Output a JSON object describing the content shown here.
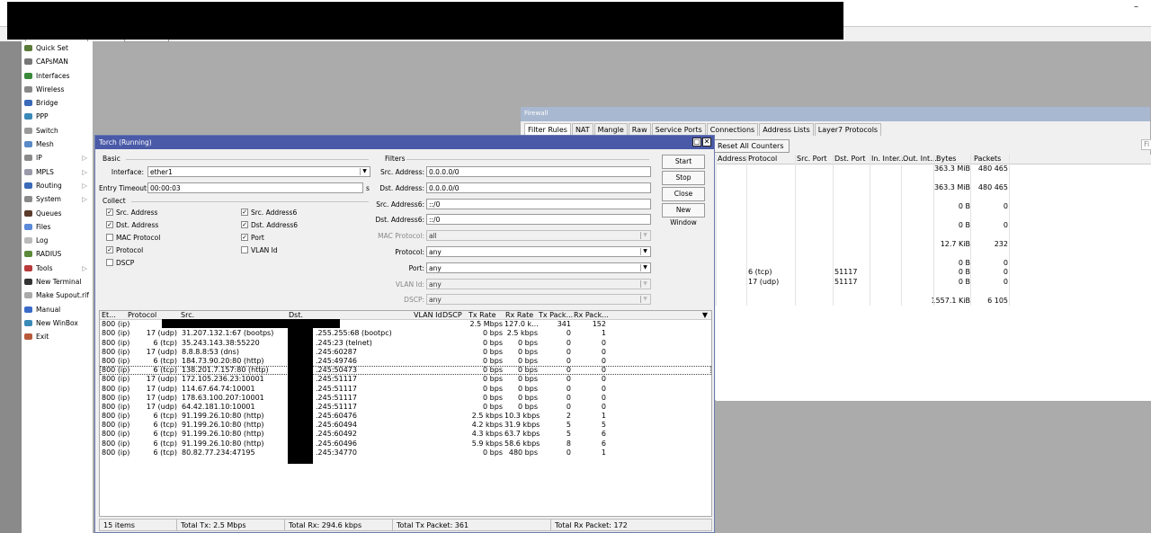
{
  "window": {
    "minimize_glyph": "–"
  },
  "sidebar": {
    "items": [
      {
        "label": "Quick Set",
        "icon": "quick-set-icon",
        "color": "#5a7a3a",
        "arrow": false
      },
      {
        "label": "CAPsMAN",
        "icon": "capsman-icon",
        "color": "#777777",
        "arrow": false
      },
      {
        "label": "Interfaces",
        "icon": "interfaces-icon",
        "color": "#3a8a3a",
        "arrow": false
      },
      {
        "label": "Wireless",
        "icon": "wireless-icon",
        "color": "#888888",
        "arrow": false
      },
      {
        "label": "Bridge",
        "icon": "bridge-icon",
        "color": "#3a6ab8",
        "arrow": false
      },
      {
        "label": "PPP",
        "icon": "ppp-icon",
        "color": "#3a8ab8",
        "arrow": false
      },
      {
        "label": "Switch",
        "icon": "switch-icon",
        "color": "#9a9a9a",
        "arrow": false
      },
      {
        "label": "Mesh",
        "icon": "mesh-icon",
        "color": "#5a8ac8",
        "arrow": false
      },
      {
        "label": "IP",
        "icon": "ip-icon",
        "color": "#8a8a8a",
        "arrow": true
      },
      {
        "label": "MPLS",
        "icon": "mpls-icon",
        "color": "#9a9aaa",
        "arrow": true
      },
      {
        "label": "Routing",
        "icon": "routing-icon",
        "color": "#3a6ab8",
        "arrow": true
      },
      {
        "label": "System",
        "icon": "system-icon",
        "color": "#8a8a8a",
        "arrow": true
      },
      {
        "label": "Queues",
        "icon": "queues-icon",
        "color": "#5a3a2a",
        "arrow": false
      },
      {
        "label": "Files",
        "icon": "files-icon",
        "color": "#5a8ad8",
        "arrow": false
      },
      {
        "label": "Log",
        "icon": "log-icon",
        "color": "#bbbbbb",
        "arrow": false
      },
      {
        "label": "RADIUS",
        "icon": "radius-icon",
        "color": "#5a8a3a",
        "arrow": false
      },
      {
        "label": "Tools",
        "icon": "tools-icon",
        "color": "#b83a3a",
        "arrow": true
      },
      {
        "label": "New Terminal",
        "icon": "terminal-icon",
        "color": "#333333",
        "arrow": false
      },
      {
        "label": "Make Supout.rif",
        "icon": "supout-icon",
        "color": "#aaaaaa",
        "arrow": false
      },
      {
        "label": "Manual",
        "icon": "manual-icon",
        "color": "#3a6ac8",
        "arrow": false
      },
      {
        "label": "New WinBox",
        "icon": "winbox-icon",
        "color": "#3a8ab8",
        "arrow": false
      },
      {
        "label": "Exit",
        "icon": "exit-icon",
        "color": "#b85a3a",
        "arrow": false
      }
    ]
  },
  "firewall": {
    "title": "Firewall",
    "tabs": [
      "Filter Rules",
      "NAT",
      "Mangle",
      "Raw",
      "Service Ports",
      "Connections",
      "Address Lists",
      "Layer7 Protocols"
    ],
    "reset_label": "Reset All Counters",
    "filter_placeholder": "Fi",
    "columns": [
      "Address",
      "Protocol",
      "Src. Port",
      "Dst. Port",
      "In. Inter...",
      "Out. Int...",
      "Bytes",
      "Packets"
    ],
    "rows": [
      {
        "proto": "",
        "dport": "",
        "bytes": "363.3 MiB",
        "packets": "480 465"
      },
      {
        "proto": "",
        "dport": "",
        "bytes": "",
        "packets": ""
      },
      {
        "proto": "",
        "dport": "",
        "bytes": "363.3 MiB",
        "packets": "480 465"
      },
      {
        "proto": "",
        "dport": "",
        "bytes": "",
        "packets": ""
      },
      {
        "proto": "",
        "dport": "",
        "bytes": "0 B",
        "packets": "0"
      },
      {
        "proto": "",
        "dport": "",
        "bytes": "",
        "packets": ""
      },
      {
        "proto": "",
        "dport": "",
        "bytes": "0 B",
        "packets": "0"
      },
      {
        "proto": "",
        "dport": "",
        "bytes": "",
        "packets": ""
      },
      {
        "proto": "",
        "dport": "",
        "bytes": "12.7 KiB",
        "packets": "232"
      },
      {
        "proto": "",
        "dport": "",
        "bytes": "",
        "packets": ""
      },
      {
        "proto": "",
        "dport": "",
        "bytes": "0 B",
        "packets": "0"
      },
      {
        "proto": "6 (tcp)",
        "dport": "51117",
        "bytes": "0 B",
        "packets": "0"
      },
      {
        "proto": "17 (udp)",
        "dport": "51117",
        "bytes": "0 B",
        "packets": "0"
      },
      {
        "proto": "",
        "dport": "",
        "bytes": "",
        "packets": ""
      },
      {
        "proto": "",
        "dport": "",
        "bytes": "1557.1 KiB",
        "packets": "6 105"
      }
    ]
  },
  "torch": {
    "title": "Torch (Running)",
    "basic_label": "Basic",
    "interface_label": "Interface:",
    "interface_value": "ether1",
    "entry_timeout_label": "Entry Timeout:",
    "entry_timeout_value": "00:00:03",
    "entry_timeout_unit": "s",
    "collect_label": "Collect",
    "collect": [
      {
        "label": "Src. Address",
        "checked": true
      },
      {
        "label": "Src. Address6",
        "checked": true
      },
      {
        "label": "Dst. Address",
        "checked": true
      },
      {
        "label": "Dst. Address6",
        "checked": true
      },
      {
        "label": "MAC Protocol",
        "checked": false
      },
      {
        "label": "Port",
        "checked": true
      },
      {
        "label": "Protocol",
        "checked": true
      },
      {
        "label": "VLAN Id",
        "checked": false
      },
      {
        "label": "DSCP",
        "checked": false
      }
    ],
    "filters_label": "Filters",
    "filters": [
      {
        "label": "Src. Address:",
        "value": "0.0.0.0/0",
        "disabled": false,
        "dropdown": false
      },
      {
        "label": "Dst. Address:",
        "value": "0.0.0.0/0",
        "disabled": false,
        "dropdown": false
      },
      {
        "label": "Src. Address6:",
        "value": "::/0",
        "disabled": false,
        "dropdown": false
      },
      {
        "label": "Dst. Address6:",
        "value": "::/0",
        "disabled": false,
        "dropdown": false
      },
      {
        "label": "MAC Protocol:",
        "value": "all",
        "disabled": true,
        "dropdown": true
      },
      {
        "label": "Protocol:",
        "value": "any",
        "disabled": false,
        "dropdown": true
      },
      {
        "label": "Port:",
        "value": "any",
        "disabled": false,
        "dropdown": true
      },
      {
        "label": "VLAN Id:",
        "value": "any",
        "disabled": true,
        "dropdown": true
      },
      {
        "label": "DSCP:",
        "value": "any",
        "disabled": true,
        "dropdown": true
      }
    ],
    "buttons": [
      "Start",
      "Stop",
      "Close",
      "New Window"
    ],
    "columns": [
      "Et...",
      "Protocol",
      "Src.",
      "Dst.",
      "VLAN Id",
      "DSCP",
      "Tx Rate",
      "Rx Rate",
      "Tx Pack...",
      "Rx Pack..."
    ],
    "rows": [
      {
        "et": "800 (ip)",
        "proto": "",
        "src": "",
        "dst": "",
        "tx": "2.5 Mbps",
        "rx": "127.0 k...",
        "txp": "341",
        "rxp": "152"
      },
      {
        "et": "800 (ip)",
        "proto": "17 (udp)",
        "src": "31.207.132.1:67 (bootps)",
        "dst": ".255.255:68 (bootpc)",
        "tx": "0 bps",
        "rx": "2.5 kbps",
        "txp": "0",
        "rxp": "1"
      },
      {
        "et": "800 (ip)",
        "proto": "6 (tcp)",
        "src": "35.243.143.38:55220",
        "dst": ".245:23 (telnet)",
        "tx": "0 bps",
        "rx": "0 bps",
        "txp": "0",
        "rxp": "0"
      },
      {
        "et": "800 (ip)",
        "proto": "17 (udp)",
        "src": "8.8.8.8:53 (dns)",
        "dst": ".245:60287",
        "tx": "0 bps",
        "rx": "0 bps",
        "txp": "0",
        "rxp": "0"
      },
      {
        "et": "800 (ip)",
        "proto": "6 (tcp)",
        "src": "184.73.90.20:80 (http)",
        "dst": ".245:49746",
        "tx": "0 bps",
        "rx": "0 bps",
        "txp": "0",
        "rxp": "0"
      },
      {
        "et": "800 (ip)",
        "proto": "6 (tcp)",
        "src": "138.201.7.157:80 (http)",
        "dst": ".245:50473",
        "tx": "0 bps",
        "rx": "0 bps",
        "txp": "0",
        "rxp": "0",
        "sel": true
      },
      {
        "et": "800 (ip)",
        "proto": "17 (udp)",
        "src": "172.105.236.23:10001",
        "dst": ".245:51117",
        "tx": "0 bps",
        "rx": "0 bps",
        "txp": "0",
        "rxp": "0"
      },
      {
        "et": "800 (ip)",
        "proto": "17 (udp)",
        "src": "114.67.64.74:10001",
        "dst": ".245:51117",
        "tx": "0 bps",
        "rx": "0 bps",
        "txp": "0",
        "rxp": "0"
      },
      {
        "et": "800 (ip)",
        "proto": "17 (udp)",
        "src": "178.63.100.207:10001",
        "dst": ".245:51117",
        "tx": "0 bps",
        "rx": "0 bps",
        "txp": "0",
        "rxp": "0"
      },
      {
        "et": "800 (ip)",
        "proto": "17 (udp)",
        "src": "64.42.181.10:10001",
        "dst": ".245:51117",
        "tx": "0 bps",
        "rx": "0 bps",
        "txp": "0",
        "rxp": "0"
      },
      {
        "et": "800 (ip)",
        "proto": "6 (tcp)",
        "src": "91.199.26.10:80 (http)",
        "dst": ".245:60476",
        "tx": "2.5 kbps",
        "rx": "10.3 kbps",
        "txp": "2",
        "rxp": "1"
      },
      {
        "et": "800 (ip)",
        "proto": "6 (tcp)",
        "src": "91.199.26.10:80 (http)",
        "dst": ".245:60494",
        "tx": "4.2 kbps",
        "rx": "31.9 kbps",
        "txp": "5",
        "rxp": "5"
      },
      {
        "et": "800 (ip)",
        "proto": "6 (tcp)",
        "src": "91.199.26.10:80 (http)",
        "dst": ".245:60492",
        "tx": "4.3 kbps",
        "rx": "63.7 kbps",
        "txp": "5",
        "rxp": "6"
      },
      {
        "et": "800 (ip)",
        "proto": "6 (tcp)",
        "src": "91.199.26.10:80 (http)",
        "dst": ".245:60496",
        "tx": "5.9 kbps",
        "rx": "58.6 kbps",
        "txp": "8",
        "rxp": "6"
      },
      {
        "et": "800 (ip)",
        "proto": "6 (tcp)",
        "src": "80.82.77.234:47195",
        "dst": ".245:34770",
        "tx": "0 bps",
        "rx": "480 bps",
        "txp": "0",
        "rxp": "1"
      }
    ],
    "status": [
      "15 items",
      "Total Tx: 2.5 Mbps",
      "Total Rx: 294.6 kbps",
      "Total Tx Packet: 361",
      "Total Rx Packet: 172"
    ]
  }
}
